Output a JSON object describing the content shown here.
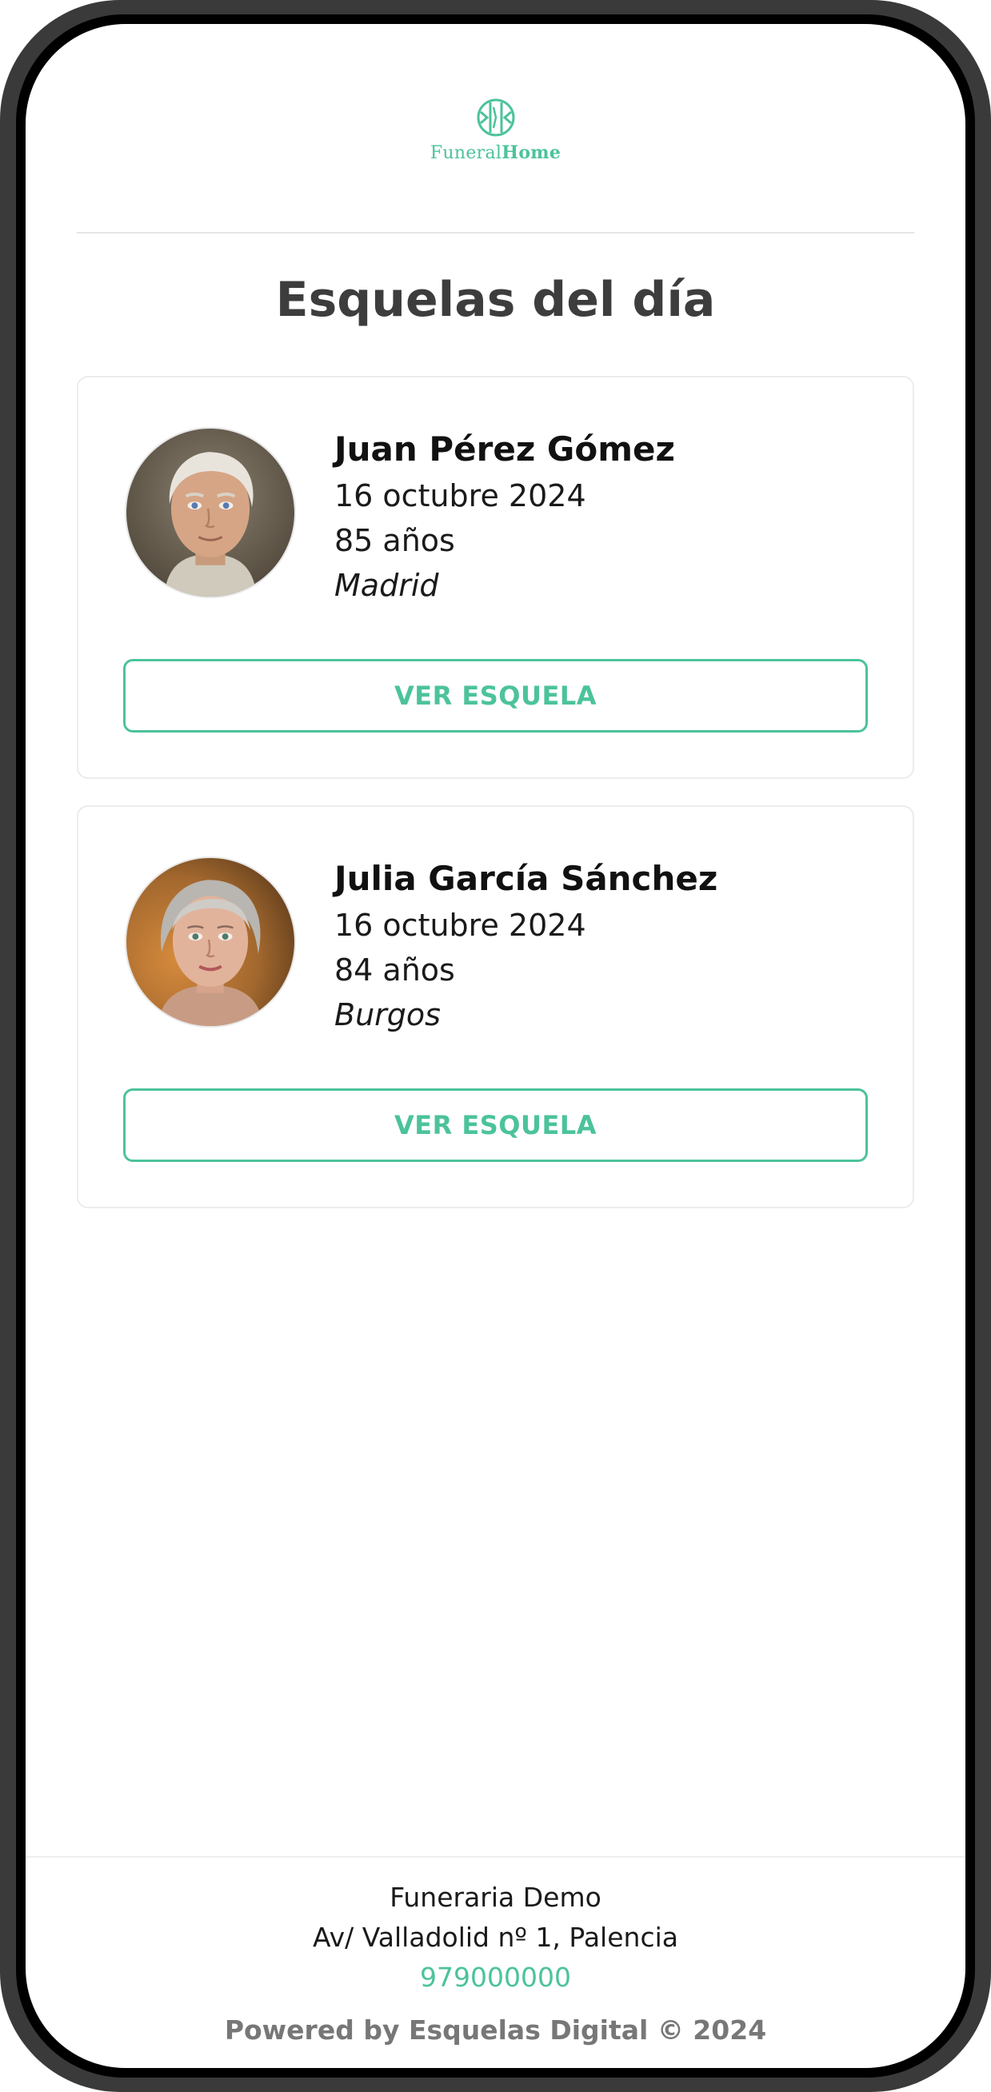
{
  "brand": {
    "logo_part1": "Funeral",
    "logo_part2": "Home",
    "accent_color": "#4cc39a"
  },
  "page": {
    "title": "Esquelas del día"
  },
  "obituaries": [
    {
      "name": "Juan Pérez Gómez",
      "date": "16 octubre 2024",
      "age": "85 años",
      "city": "Madrid",
      "button_label": "VER ESQUELA"
    },
    {
      "name": "Julia García Sánchez",
      "date": "16 octubre 2024",
      "age": "84 años",
      "city": "Burgos",
      "button_label": "VER ESQUELA"
    }
  ],
  "footer": {
    "company": "Funeraria Demo",
    "address": "Av/ Valladolid nº 1, Palencia",
    "phone": "979000000",
    "powered_by": "Powered by Esquelas Digital © 2024"
  }
}
